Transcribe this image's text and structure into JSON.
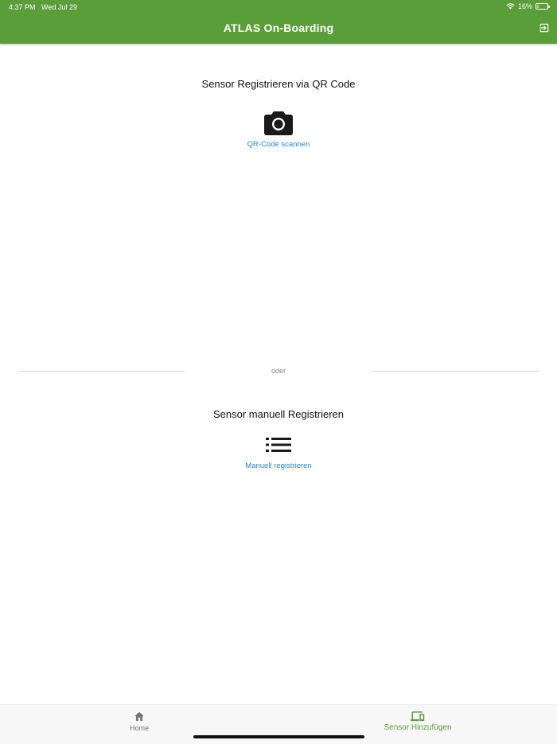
{
  "status_bar": {
    "time": "4:37 PM",
    "date": "Wed Jul 29",
    "battery": "16%",
    "battery_level": 0.16
  },
  "appbar": {
    "title": "ATLAS On-Boarding",
    "color": "#5a9e3a",
    "action_icon": "logout-icon"
  },
  "qr_section": {
    "title": "Sensor Registrieren via QR Code",
    "icon": "camera-icon",
    "link_label": "QR-Code scannen"
  },
  "divider": {
    "label": "oder"
  },
  "manual_section": {
    "title": "Sensor manuell Registrieren",
    "icon": "list-icon",
    "link_label": "Manuell registrieren"
  },
  "bottom_nav": {
    "items": [
      {
        "label": "Home",
        "icon": "home-icon",
        "active": false
      },
      {
        "label": "Sensor Hinzufügen",
        "icon": "devices-icon",
        "active": true
      }
    ],
    "active_color": "#5a9e3a",
    "inactive_color": "#757575"
  },
  "link_color": "#1e88e5"
}
